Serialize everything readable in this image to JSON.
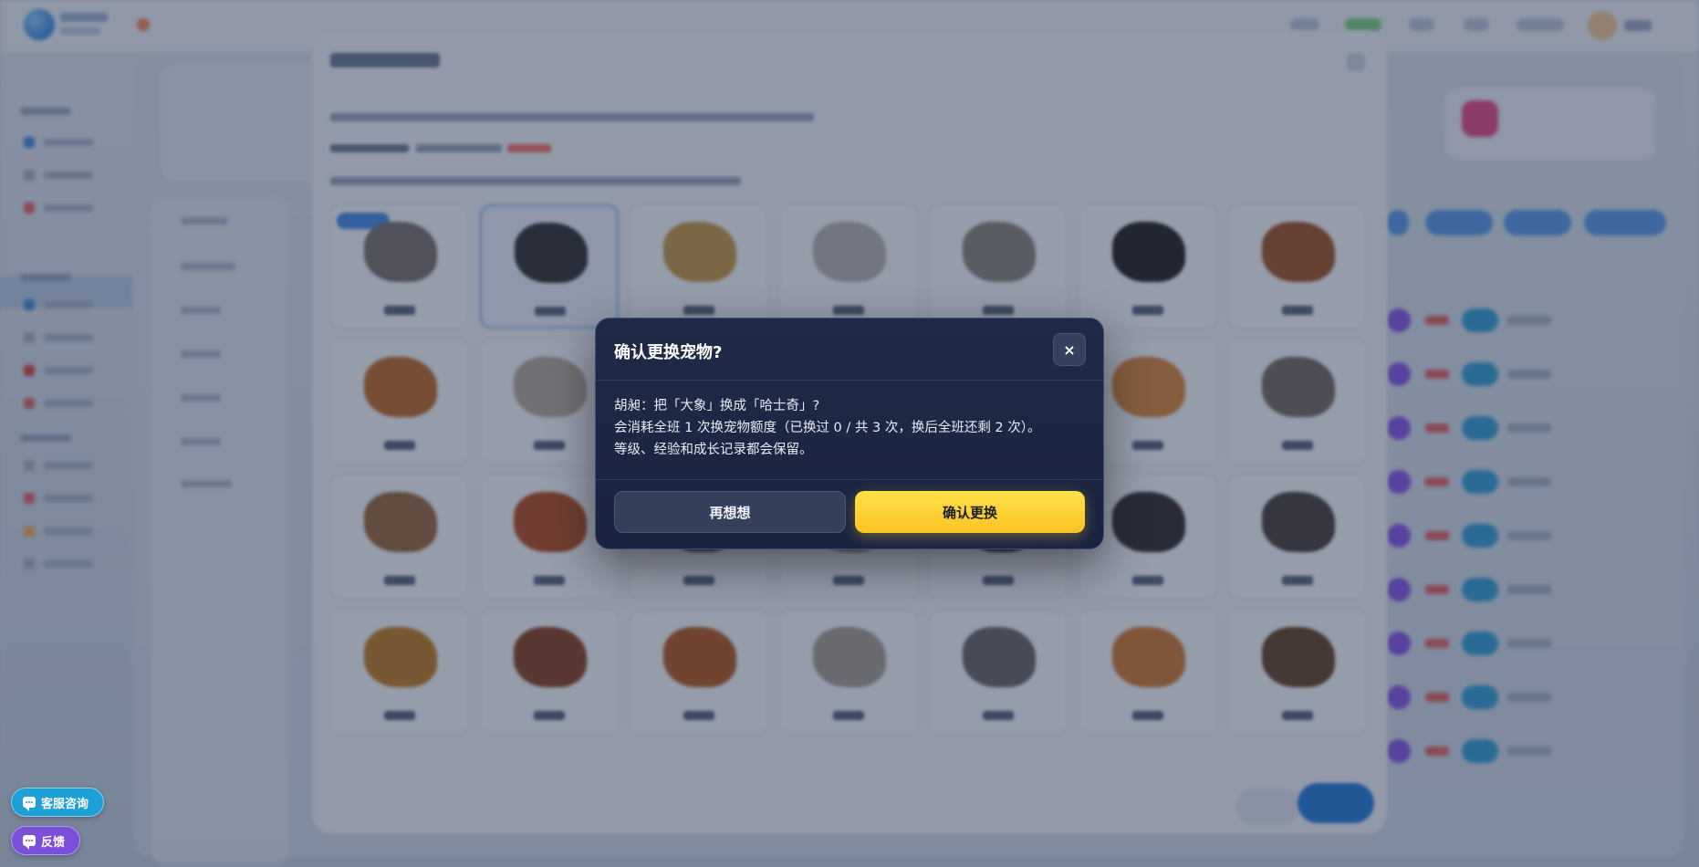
{
  "confirm_modal": {
    "title": "确认更换宠物?",
    "close_symbol": "×",
    "body_lines": [
      "胡昶：把「大象」换成「哈士奇」?",
      "会消耗全班 1 次换宠物额度（已换过 0 / 共 3 次，换后全班还剩 2 次）。",
      "等级、经验和成长记录都会保留。"
    ],
    "cancel_label": "再想想",
    "confirm_label": "确认更换",
    "confirm_color": "#fbc323"
  },
  "floating": {
    "consult_label": "客服咨询",
    "feedback_label": "反馈",
    "consult_color": "#1ea0d6",
    "feedback_color": "#7c4fd8"
  },
  "icons": {
    "close": "close-icon",
    "chat": "chat-bubble-icon"
  }
}
